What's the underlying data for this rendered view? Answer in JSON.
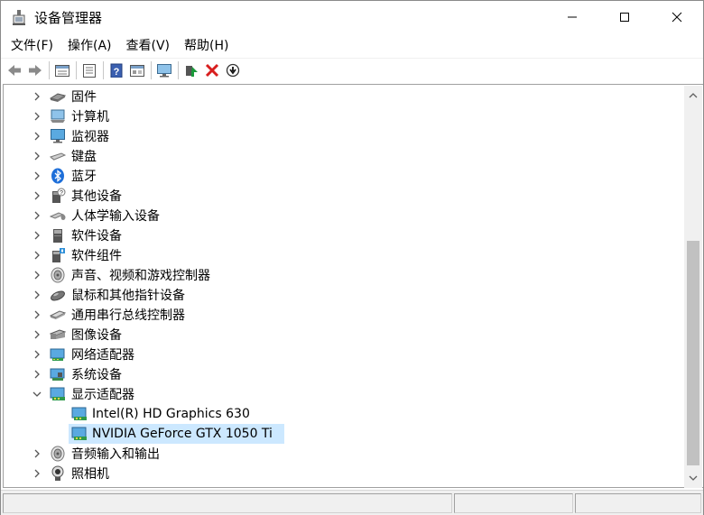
{
  "window": {
    "title": "设备管理器"
  },
  "menu": [
    "文件(F)",
    "操作(A)",
    "查看(V)",
    "帮助(H)"
  ],
  "toolbar": [
    "back-arrow-icon",
    "forward-arrow-icon",
    "properties-icon",
    "list-icon",
    "help-icon",
    "view-icon",
    "monitor-icon",
    "update-driver-icon",
    "uninstall-icon",
    "scan-hardware-icon"
  ],
  "tree": {
    "items": [
      {
        "label": "固件",
        "icon": "firmware-icon",
        "state": "collapsed"
      },
      {
        "label": "计算机",
        "icon": "computer-icon",
        "state": "collapsed"
      },
      {
        "label": "监视器",
        "icon": "monitor-icon",
        "state": "collapsed"
      },
      {
        "label": "键盘",
        "icon": "keyboard-icon",
        "state": "collapsed"
      },
      {
        "label": "蓝牙",
        "icon": "bluetooth-icon",
        "state": "collapsed"
      },
      {
        "label": "其他设备",
        "icon": "other-devices-icon",
        "state": "collapsed"
      },
      {
        "label": "人体学输入设备",
        "icon": "hid-icon",
        "state": "collapsed"
      },
      {
        "label": "软件设备",
        "icon": "software-device-icon",
        "state": "collapsed"
      },
      {
        "label": "软件组件",
        "icon": "software-component-icon",
        "state": "collapsed"
      },
      {
        "label": "声音、视频和游戏控制器",
        "icon": "speaker-icon",
        "state": "collapsed"
      },
      {
        "label": "鼠标和其他指针设备",
        "icon": "mouse-icon",
        "state": "collapsed"
      },
      {
        "label": "通用串行总线控制器",
        "icon": "usb-icon",
        "state": "collapsed"
      },
      {
        "label": "图像设备",
        "icon": "camera-device-icon",
        "state": "collapsed"
      },
      {
        "label": "网络适配器",
        "icon": "network-adapter-icon",
        "state": "collapsed"
      },
      {
        "label": "系统设备",
        "icon": "system-device-icon",
        "state": "collapsed"
      },
      {
        "label": "显示适配器",
        "icon": "display-adapter-icon",
        "state": "expanded"
      },
      {
        "label": "Intel(R) HD Graphics 630",
        "icon": "display-adapter-icon",
        "state": "child"
      },
      {
        "label": "NVIDIA GeForce GTX 1050 Ti",
        "icon": "display-adapter-icon",
        "state": "child-selected"
      },
      {
        "label": "音频输入和输出",
        "icon": "speaker-icon",
        "state": "collapsed"
      },
      {
        "label": "照相机",
        "icon": "webcam-icon",
        "state": "collapsed"
      }
    ]
  },
  "colors": {
    "selection": "#cce8ff",
    "bluetooth": "#1e6fd9",
    "uninstall": "#d81e1e",
    "update": "#1a9a3a"
  }
}
